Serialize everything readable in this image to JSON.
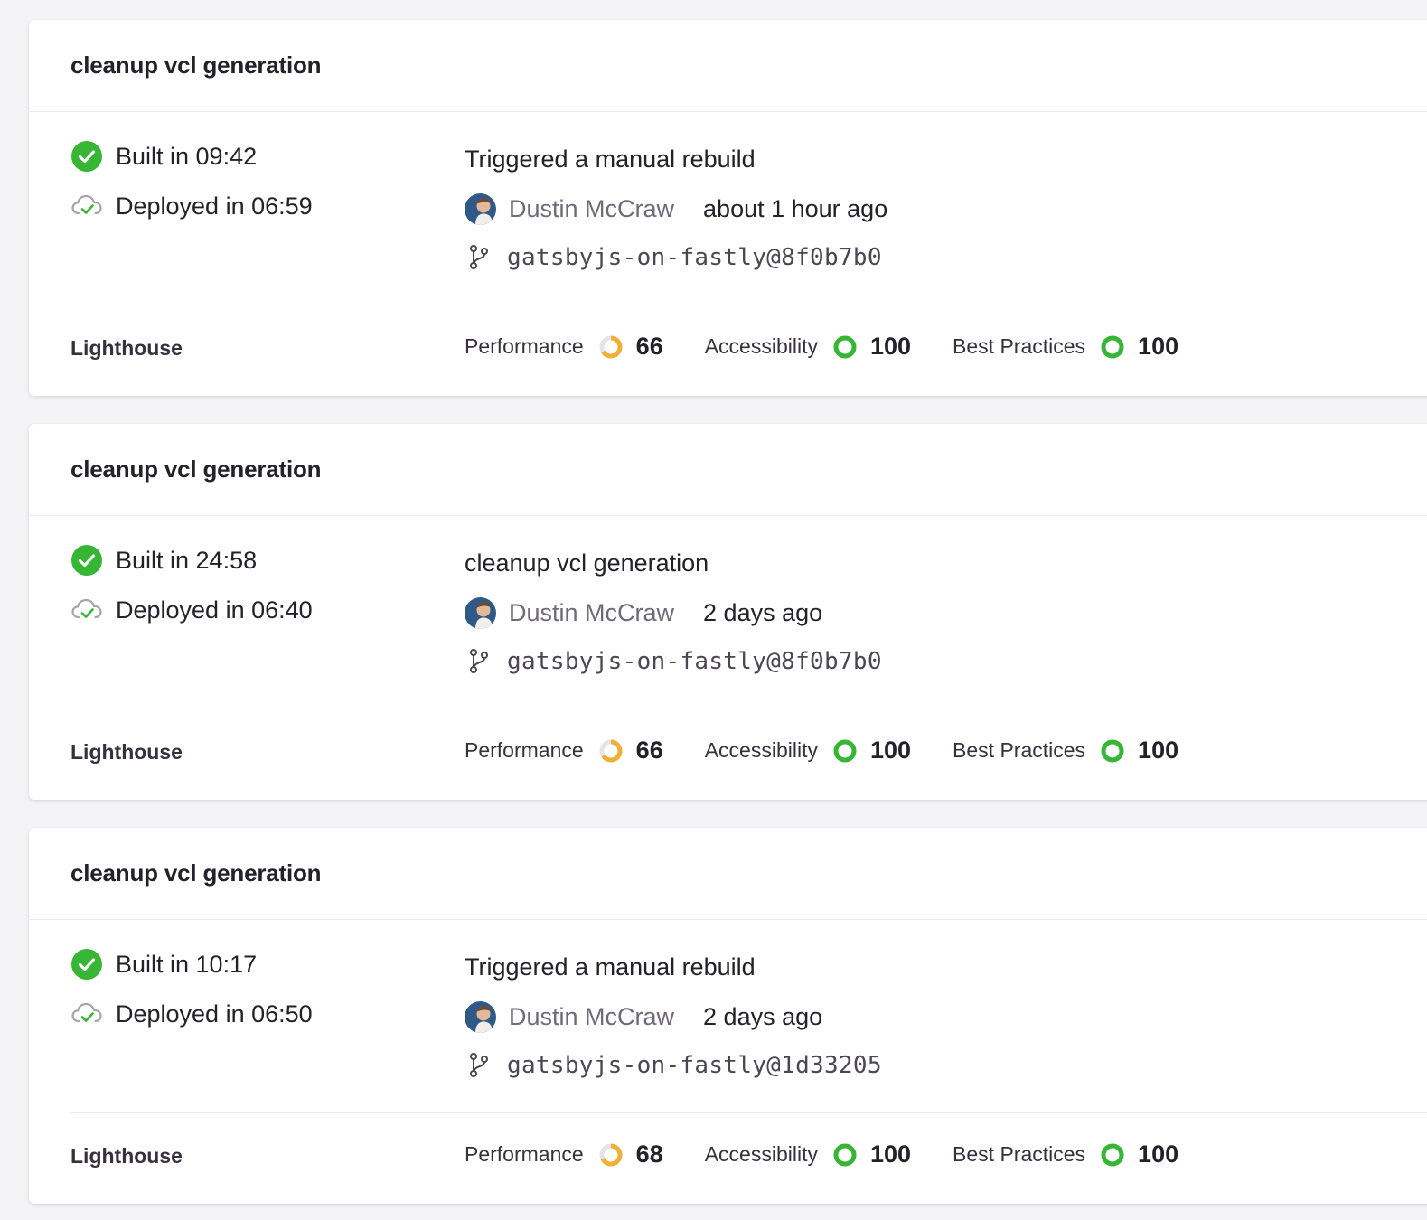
{
  "colors": {
    "success": "#37b635",
    "warning": "#f0b038",
    "gauge_track": "#e6e4ea"
  },
  "icons": {
    "built": "check-circle-icon",
    "deployed": "cloud-check-icon",
    "branch": "git-branch-icon",
    "avatar": "avatar"
  },
  "builds": [
    {
      "title": "cleanup vcl generation",
      "built": "Built in 09:42",
      "deployed": "Deployed in 06:59",
      "commit_message": "Triggered a manual rebuild",
      "author": "Dustin McCraw",
      "time_ago": "about 1 hour ago",
      "branch": "gatsbyjs-on-fastly@8f0b7b0",
      "lighthouse_label": "Lighthouse",
      "scores": [
        {
          "label": "Performance",
          "value": "66",
          "status": "warning"
        },
        {
          "label": "Accessibility",
          "value": "100",
          "status": "success"
        },
        {
          "label": "Best Practices",
          "value": "100",
          "status": "success"
        }
      ]
    },
    {
      "title": "cleanup vcl generation",
      "built": "Built in 24:58",
      "deployed": "Deployed in 06:40",
      "commit_message": "cleanup vcl generation",
      "author": "Dustin McCraw",
      "time_ago": "2 days ago",
      "branch": "gatsbyjs-on-fastly@8f0b7b0",
      "lighthouse_label": "Lighthouse",
      "scores": [
        {
          "label": "Performance",
          "value": "66",
          "status": "warning"
        },
        {
          "label": "Accessibility",
          "value": "100",
          "status": "success"
        },
        {
          "label": "Best Practices",
          "value": "100",
          "status": "success"
        }
      ]
    },
    {
      "title": "cleanup vcl generation",
      "built": "Built in 10:17",
      "deployed": "Deployed in 06:50",
      "commit_message": "Triggered a manual rebuild",
      "author": "Dustin McCraw",
      "time_ago": "2 days ago",
      "branch": "gatsbyjs-on-fastly@1d33205",
      "lighthouse_label": "Lighthouse",
      "scores": [
        {
          "label": "Performance",
          "value": "68",
          "status": "warning"
        },
        {
          "label": "Accessibility",
          "value": "100",
          "status": "success"
        },
        {
          "label": "Best Practices",
          "value": "100",
          "status": "success"
        }
      ]
    }
  ]
}
